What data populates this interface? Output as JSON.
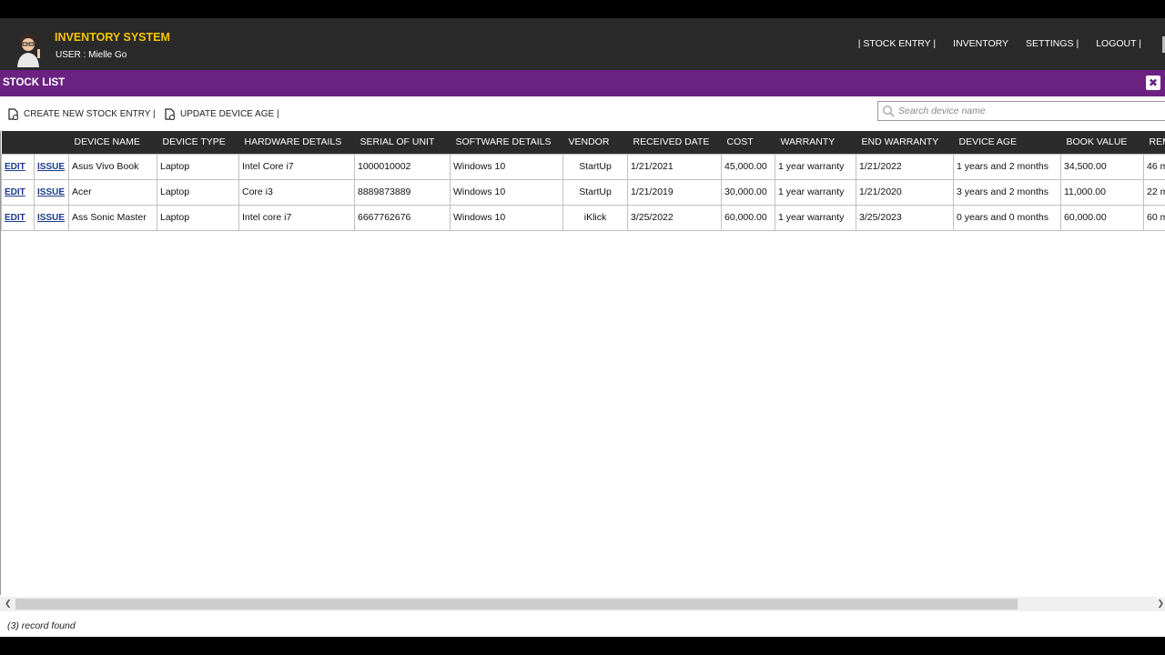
{
  "header": {
    "title": "INVENTORY SYSTEM",
    "user_line": "USER : Mielle Go",
    "nav": [
      "| STOCK ENTRY |",
      "INVENTORY",
      "SETTINGS |",
      "LOGOUT |"
    ]
  },
  "section": {
    "title": "STOCK LIST",
    "close_glyph": "✖"
  },
  "toolbar": {
    "create_label": "CREATE NEW STOCK ENTRY |",
    "update_label": "UPDATE DEVICE AGE |",
    "search_placeholder": "Search device name"
  },
  "table": {
    "columns": [
      "",
      "",
      "DEVICE NAME",
      "DEVICE TYPE",
      "HARDWARE DETAILS",
      "SERIAL OF UNIT",
      "SOFTWARE DETAILS",
      "VENDOR",
      "RECEIVED DATE",
      "COST",
      "WARRANTY",
      "END WARRANTY",
      "DEVICE AGE",
      "BOOK VALUE",
      "REM"
    ],
    "action_edit": "EDIT",
    "action_issue": "ISSUE",
    "rows": [
      [
        "Asus Vivo Book",
        "Laptop",
        "Intel Core i7",
        "1000010002",
        "Windows 10",
        "StartUp",
        "1/21/2021",
        "45,000.00",
        "1 year warranty",
        "1/21/2022",
        "1 years and 2 months",
        "34,500.00",
        "46 m"
      ],
      [
        "Acer",
        "Laptop",
        "Core i3",
        "8889873889",
        "Windows 10",
        "StartUp",
        "1/21/2019",
        "30,000.00",
        "1 year warranty",
        "1/21/2020",
        "3 years and 2 months",
        "11,000.00",
        "22 m"
      ],
      [
        "Ass Sonic Master",
        "Laptop",
        "Intel core i7",
        "6667762676",
        "Windows 10",
        "iKlick",
        "3/25/2022",
        "60,000.00",
        "1 year warranty",
        "3/25/2023",
        "0 years and 0 months",
        "60,000.00",
        "60 m"
      ]
    ]
  },
  "status": "(3) record found",
  "colors": {
    "topbar": "#2a2a2a",
    "title_yellow": "#f5c400",
    "section_purple": "#6a2180",
    "header_row": "#2b2b2b"
  }
}
